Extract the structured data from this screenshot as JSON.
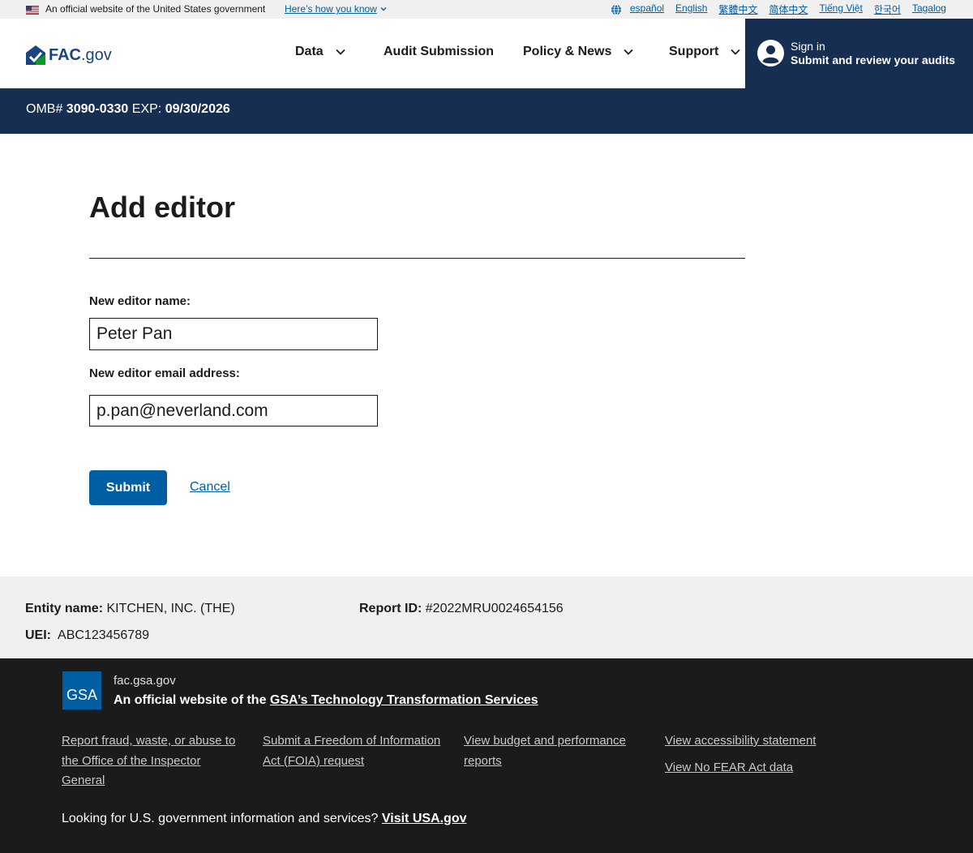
{
  "gov_banner": {
    "official": "An official website of the United States government",
    "how_link": "Here’s how you know",
    "languages": [
      "español",
      "English",
      "繁體中文",
      "简体中文",
      "Tiếng Việt",
      "한국어",
      "Tagalog"
    ]
  },
  "header": {
    "logo_bold": "FAC",
    "logo_rest": ".gov",
    "nav": {
      "data": "Data",
      "audit_submission": "Audit Submission",
      "policy_news": "Policy & News",
      "support": "Support"
    },
    "signin": {
      "line1": "Sign in",
      "line2": "Submit and review your audits"
    }
  },
  "omb": {
    "prefix": "OMB#",
    "number": "3090-0330",
    "exp_label": "EXP:",
    "exp_date": "09/30/2026"
  },
  "form": {
    "title": "Add editor",
    "name_label": "New editor name:",
    "name_value": "Peter Pan",
    "email_label": "New editor email address:",
    "email_value": "p.pan@neverland.com",
    "submit": "Submit",
    "cancel": "Cancel"
  },
  "entity": {
    "name_label": "Entity name:",
    "name_value": "KITCHEN, INC. (THE)",
    "report_label": "Report ID:",
    "report_value": "#2022MRU0024654156",
    "uei_label": "UEI:",
    "uei_value": "ABC123456789"
  },
  "footer": {
    "gsa_logo_text": "GSA",
    "domain": "fac.gsa.gov",
    "official_prefix": "An official website of the",
    "official_link": "GSA’s Technology Transformation Services",
    "links": {
      "fraud": "Report fraud, waste, or abuse to the Office of the Inspector General",
      "foia": "Submit a Freedom of Information Act (FOIA) request",
      "budget": "View budget and performance reports",
      "accessibility": "View accessibility statement",
      "nofear": "View No FEAR Act data"
    },
    "looking": "Looking for U.S. government information and services?",
    "usa_link": "Visit USA.gov"
  },
  "colors": {
    "primary": "#005ea2",
    "navy": "#162e51",
    "footer_bg": "#1b1b1b",
    "entity_bg": "#eeeff0"
  }
}
